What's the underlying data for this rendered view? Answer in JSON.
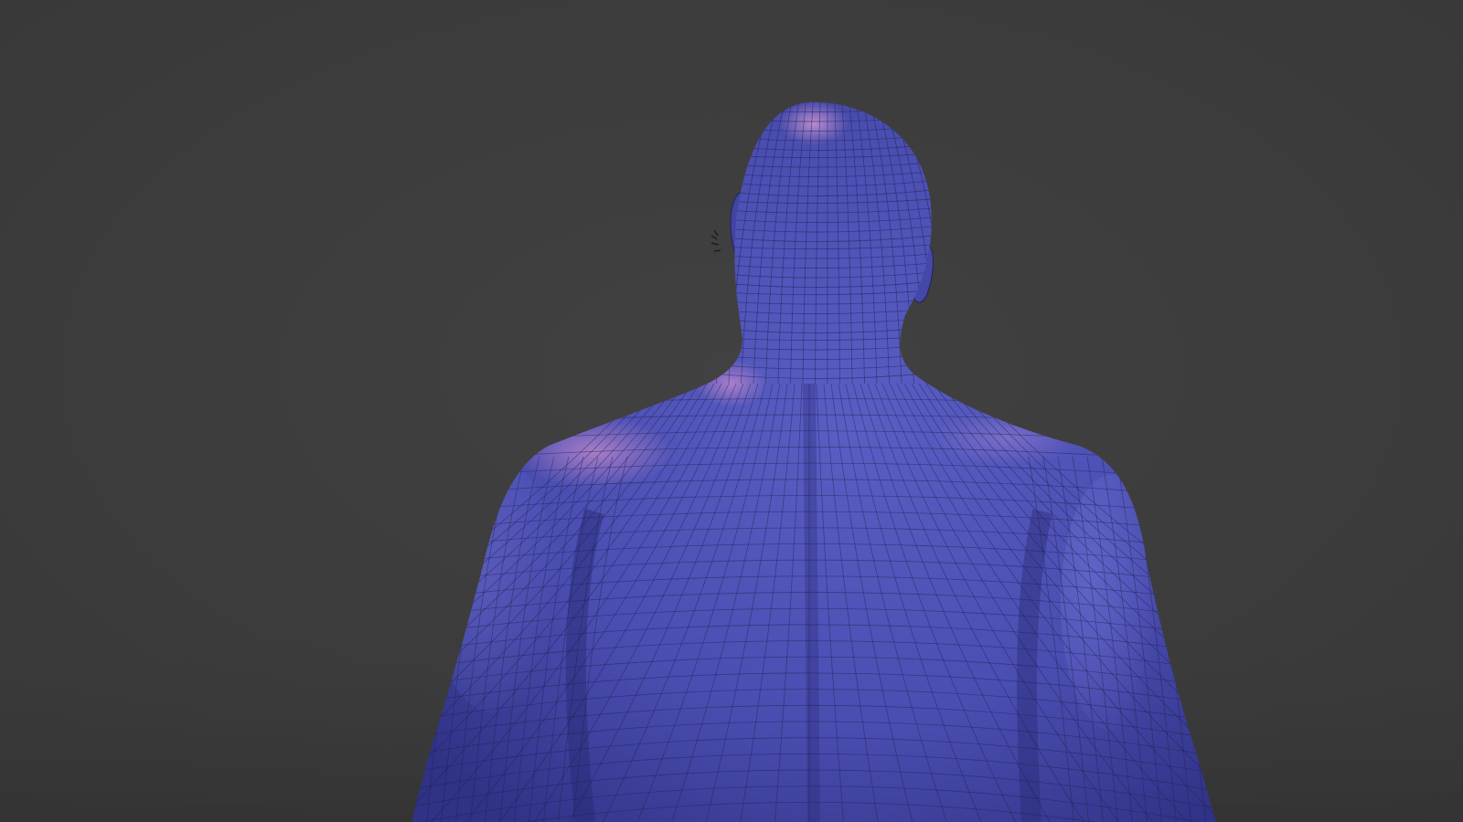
{
  "viewport": {
    "background_color": "#3c3c3c",
    "floor_color": "#363636",
    "wireframe_color": "#1f2050",
    "subject": "human-back-mesh-icon",
    "colors": {
      "skin_base": "#4a4db0",
      "skin_light": "#6f72d4",
      "skin_dark": "#2f3285",
      "highlight": "#c78ccd"
    }
  }
}
